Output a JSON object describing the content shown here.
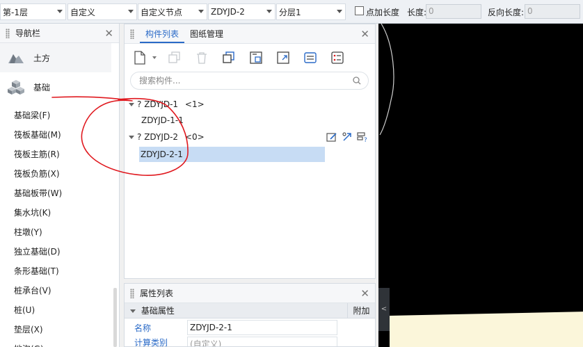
{
  "toolbar": {
    "floor": "第-1层",
    "type": "自定义",
    "node": "自定义节点",
    "component": "ZDYJD-2",
    "layer": "分层1",
    "point_add_length_label": "点加长度",
    "length_label": "长度:",
    "length_value": "0",
    "reverse_length_label": "反向长度:",
    "reverse_length_value": "0"
  },
  "nav": {
    "title": "导航栏",
    "categories": [
      {
        "label": "土方",
        "icon": "earthwork-icon"
      },
      {
        "label": "基础",
        "icon": "foundation-icon"
      }
    ],
    "items": [
      "基础梁(F)",
      "筏板基础(M)",
      "筏板主筋(R)",
      "筏板负筋(X)",
      "基础板带(W)",
      "集水坑(K)",
      "柱墩(Y)",
      "独立基础(D)",
      "条形基础(T)",
      "桩承台(V)",
      "桩(U)",
      "垫层(X)",
      "地沟(G)"
    ]
  },
  "component_panel": {
    "tabs": [
      "构件列表",
      "图纸管理"
    ],
    "search_placeholder": "搜索构件...",
    "tree": [
      {
        "label": "ZDYJD-1",
        "count": "<1>",
        "children": [
          "ZDYJD-1-1"
        ]
      },
      {
        "label": "ZDYJD-2",
        "count": "<0>",
        "children": [
          "ZDYJD-2-1"
        ]
      }
    ]
  },
  "properties": {
    "title": "属性列表",
    "group": "基础属性",
    "extra_col": "附加",
    "rows": [
      {
        "name": "名称",
        "value": "ZDYJD-2-1"
      },
      {
        "name": "计算类别",
        "value": "(自定义)"
      }
    ]
  },
  "colors": {
    "accent": "#2a6ac7",
    "selection": "#c7dcf4",
    "annotation": "#e0191f"
  }
}
